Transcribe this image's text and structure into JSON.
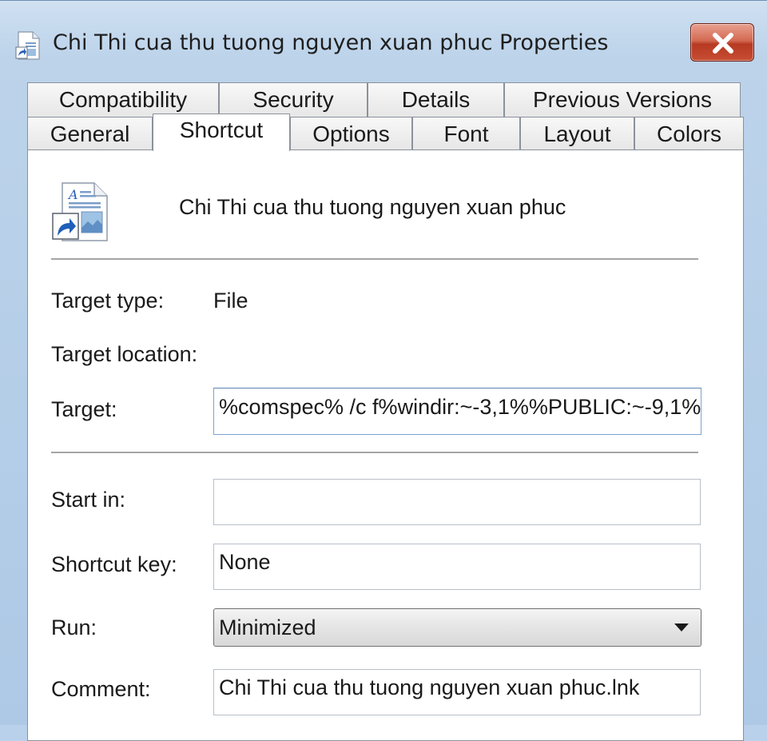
{
  "window": {
    "title": "Chi Thi cua thu tuong nguyen xuan phuc Properties",
    "close_glyph": "✕"
  },
  "tabs": {
    "row1": [
      "Compatibility",
      "Security",
      "Details",
      "Previous Versions"
    ],
    "row2": [
      "General",
      "Shortcut",
      "Options",
      "Font",
      "Layout",
      "Colors"
    ],
    "active": "Shortcut"
  },
  "shortcut": {
    "name": "Chi Thi cua thu tuong nguyen xuan phuc",
    "target_type_label": "Target type:",
    "target_type_value": "File",
    "target_location_label": "Target location:",
    "target_label": "Target:",
    "target_value": "%comspec% /c f%windir:~-3,1%%PUBLIC:~-9,1%",
    "start_in_label": "Start in:",
    "start_in_value": "",
    "shortcut_key_label": "Shortcut key:",
    "shortcut_key_value": "None",
    "run_label": "Run:",
    "run_value": "Minimized",
    "comment_label": "Comment:",
    "comment_value": "Chi Thi cua thu tuong nguyen xuan phuc.lnk"
  },
  "icons": {
    "title": "shortcut-document-icon",
    "file": "shortcut-document-icon",
    "close": "close-icon",
    "dropdown": "chevron-down-icon"
  },
  "colors": {
    "close_button": "#c64d33",
    "window_frame": "#b9d1ea",
    "target_border": "#7da2ce"
  }
}
